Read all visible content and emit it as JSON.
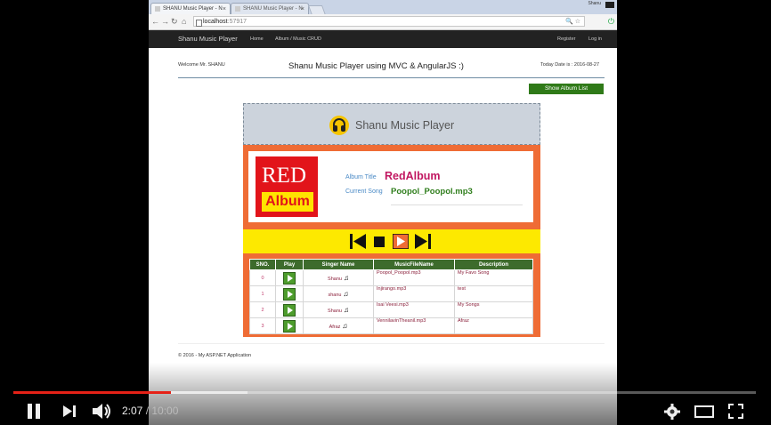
{
  "browser": {
    "tabs": [
      {
        "label": "SHANU Music Player - N"
      },
      {
        "label": "SHANU Music Player - N"
      }
    ],
    "window_user": "Shanu",
    "address": {
      "host": "localhost",
      "port": ":57917"
    },
    "ext_icon": "plugin-icon"
  },
  "site": {
    "brand": "Shanu Music Player",
    "nav": [
      "Home",
      "Album / Music CRUD"
    ],
    "right_nav": [
      "Register",
      "Log in"
    ]
  },
  "page": {
    "welcome": "Welcome Mr. SHANU",
    "heading": "Shanu Music Player using MVC & AngularJS :)",
    "today": "Today Date is : 2016-08-27",
    "show_album_button": "Show Album List",
    "player_title": "Shanu Music Player",
    "cover": {
      "line1": "RED",
      "line2": "Album"
    },
    "album_title_label": "Album Title",
    "album_title": "RedAlbum",
    "current_song_label": "Current Song",
    "current_song": "Poopol_Poopol.mp3",
    "controls": [
      "previous-icon",
      "stop-icon",
      "play-icon",
      "next-icon"
    ],
    "table": {
      "headers": [
        "SNO.",
        "Play",
        "Singer Name",
        "MusicFileName",
        "Description"
      ],
      "rows": [
        {
          "sno": "0",
          "singer": "Shanu",
          "file": "Poopol_Poopol.mp3",
          "desc": "My Favo Song"
        },
        {
          "sno": "1",
          "singer": "shanu",
          "file": "Injirango.mp3",
          "desc": "test"
        },
        {
          "sno": "2",
          "singer": "Shanu",
          "file": "Isai Veesi.mp3",
          "desc": "My Songs"
        },
        {
          "sno": "3",
          "singer": "Afraz",
          "file": "VennilavinTheanil.mp3",
          "desc": "Afraz"
        }
      ]
    },
    "footer": "© 2016 - My ASP.NET Application"
  },
  "video_player": {
    "current_time": "2:07",
    "separator": " / ",
    "duration": "10:00",
    "played_fraction": 0.212,
    "buffered_fraction": 0.315,
    "accent": "#e62117"
  }
}
